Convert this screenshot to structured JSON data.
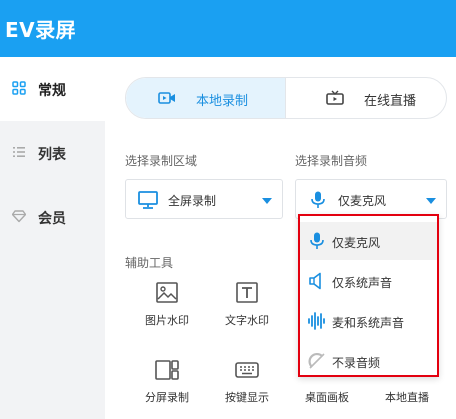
{
  "app": {
    "title": "EV录屏"
  },
  "sidebar": {
    "items": [
      {
        "label": "常规",
        "icon": "grid-icon",
        "active": true
      },
      {
        "label": "列表",
        "icon": "list-icon",
        "active": false
      },
      {
        "label": "会员",
        "icon": "diamond-icon",
        "active": false
      }
    ]
  },
  "mode": {
    "local_label": "本地录制",
    "live_label": "在线直播",
    "selected": "本地录制"
  },
  "record_area": {
    "section_label": "选择录制区域",
    "value": "全屏录制"
  },
  "record_audio": {
    "section_label": "选择录制音频",
    "value": "仅麦克风",
    "options": [
      {
        "label": "仅麦克风",
        "icon": "microphone-icon",
        "highlighted": true
      },
      {
        "label": "仅系统声音",
        "icon": "speaker-icon",
        "highlighted": false
      },
      {
        "label": "麦和系统声音",
        "icon": "waveform-icon",
        "highlighted": false
      },
      {
        "label": "不录音频",
        "icon": "mute-icon",
        "highlighted": false
      }
    ]
  },
  "tools": {
    "section_label": "辅助工具",
    "items": [
      {
        "label": "图片水印",
        "icon": "image-icon"
      },
      {
        "label": "文字水印",
        "icon": "text-icon"
      },
      {
        "label": "分屏录制",
        "icon": "split-screen-icon"
      },
      {
        "label": "按键显示",
        "icon": "keyboard-icon"
      },
      {
        "label": "桌面画板",
        "icon": ""
      },
      {
        "label": "本地直播",
        "icon": ""
      }
    ]
  },
  "colors": {
    "accent": "#1aa0f2",
    "highlight_border": "#e3000f"
  }
}
